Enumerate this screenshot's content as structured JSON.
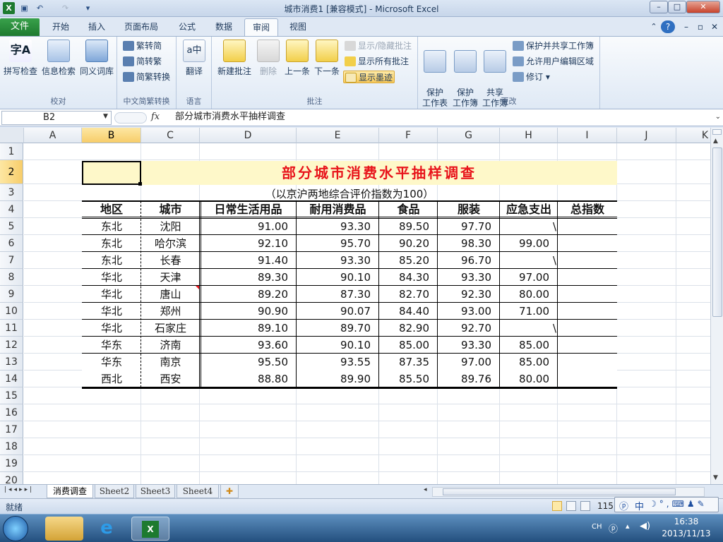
{
  "window": {
    "title": "城市消费1  [兼容模式] - Microsoft Excel"
  },
  "ribbon": {
    "file_tab": "文件",
    "tabs": [
      "开始",
      "插入",
      "页面布局",
      "公式",
      "数据",
      "审阅",
      "视图"
    ],
    "groups": {
      "proofing": {
        "label": "校对",
        "buttons": [
          "拼写检查",
          "信息检索",
          "同义词库"
        ]
      },
      "chinese": {
        "label": "中文简繁转换",
        "buttons": [
          "繁转简",
          "简转繁",
          "简繁转换"
        ]
      },
      "language": {
        "label": "语言",
        "buttons": [
          "翻译"
        ]
      },
      "comments": {
        "label": "批注",
        "buttons": [
          "新建批注",
          "删除",
          "上一条",
          "下一条"
        ],
        "small": [
          "显示/隐藏批注",
          "显示所有批注",
          "显示墨迹"
        ]
      },
      "changes": {
        "label": "更改",
        "buttons": [
          "保护\n工作表",
          "保护\n工作簿",
          "共享\n工作簿"
        ],
        "small": [
          "保护并共享工作簿",
          "允许用户编辑区域",
          "修订 ▾"
        ]
      }
    }
  },
  "formula_bar": {
    "name_box": "B2",
    "fx": "fx",
    "content": "部分城市消费水平抽样调查"
  },
  "sheet": {
    "columns": [
      "A",
      "B",
      "C",
      "D",
      "E",
      "F",
      "G",
      "H",
      "I",
      "J",
      "K"
    ],
    "selected_column": "B",
    "selected_row": "2",
    "row_numbers": [
      "1",
      "2",
      "3",
      "4",
      "5",
      "6",
      "7",
      "8",
      "9",
      "10",
      "11",
      "12",
      "13",
      "14",
      "15",
      "16",
      "17",
      "18",
      "19",
      "20"
    ],
    "title": "部分城市消费水平抽样调查",
    "subtitle": "（以京沪两地综合评价指数为100）",
    "headers": [
      "地区",
      "城市",
      "日常生活用品",
      "耐用消费品",
      "食品",
      "服装",
      "应急支出",
      "总指数"
    ],
    "rows": [
      [
        "东北",
        "沈阳",
        "91.00",
        "93.30",
        "89.50",
        "97.70",
        "\\",
        ""
      ],
      [
        "东北",
        "哈尔滨",
        "92.10",
        "95.70",
        "90.20",
        "98.30",
        "99.00",
        ""
      ],
      [
        "东北",
        "长春",
        "91.40",
        "93.30",
        "85.20",
        "96.70",
        "\\",
        ""
      ],
      [
        "华北",
        "天津",
        "89.30",
        "90.10",
        "84.30",
        "93.30",
        "97.00",
        ""
      ],
      [
        "华北",
        "唐山",
        "89.20",
        "87.30",
        "82.70",
        "92.30",
        "80.00",
        ""
      ],
      [
        "华北",
        "郑州",
        "90.90",
        "90.07",
        "84.40",
        "93.00",
        "71.00",
        ""
      ],
      [
        "华北",
        "石家庄",
        "89.10",
        "89.70",
        "82.90",
        "92.70",
        "\\",
        ""
      ],
      [
        "华东",
        "济南",
        "93.60",
        "90.10",
        "85.00",
        "93.30",
        "85.00",
        ""
      ],
      [
        "华东",
        "南京",
        "95.50",
        "93.55",
        "87.35",
        "97.00",
        "85.00",
        ""
      ],
      [
        "西北",
        "西安",
        "88.80",
        "89.90",
        "85.50",
        "89.76",
        "80.00",
        ""
      ]
    ]
  },
  "sheet_tabs": [
    "消费调查",
    "Sheet2",
    "Sheet3",
    "Sheet4"
  ],
  "status": {
    "ready": "就绪",
    "zoom": "115"
  },
  "ime": "中",
  "taskbar": {
    "lang": "CH",
    "time": "16:38",
    "date": "2013/11/13"
  },
  "colors": {
    "title_red": "#e8141b",
    "selected_fill": "#fef8c9",
    "file_green": "#2b8f3c"
  }
}
